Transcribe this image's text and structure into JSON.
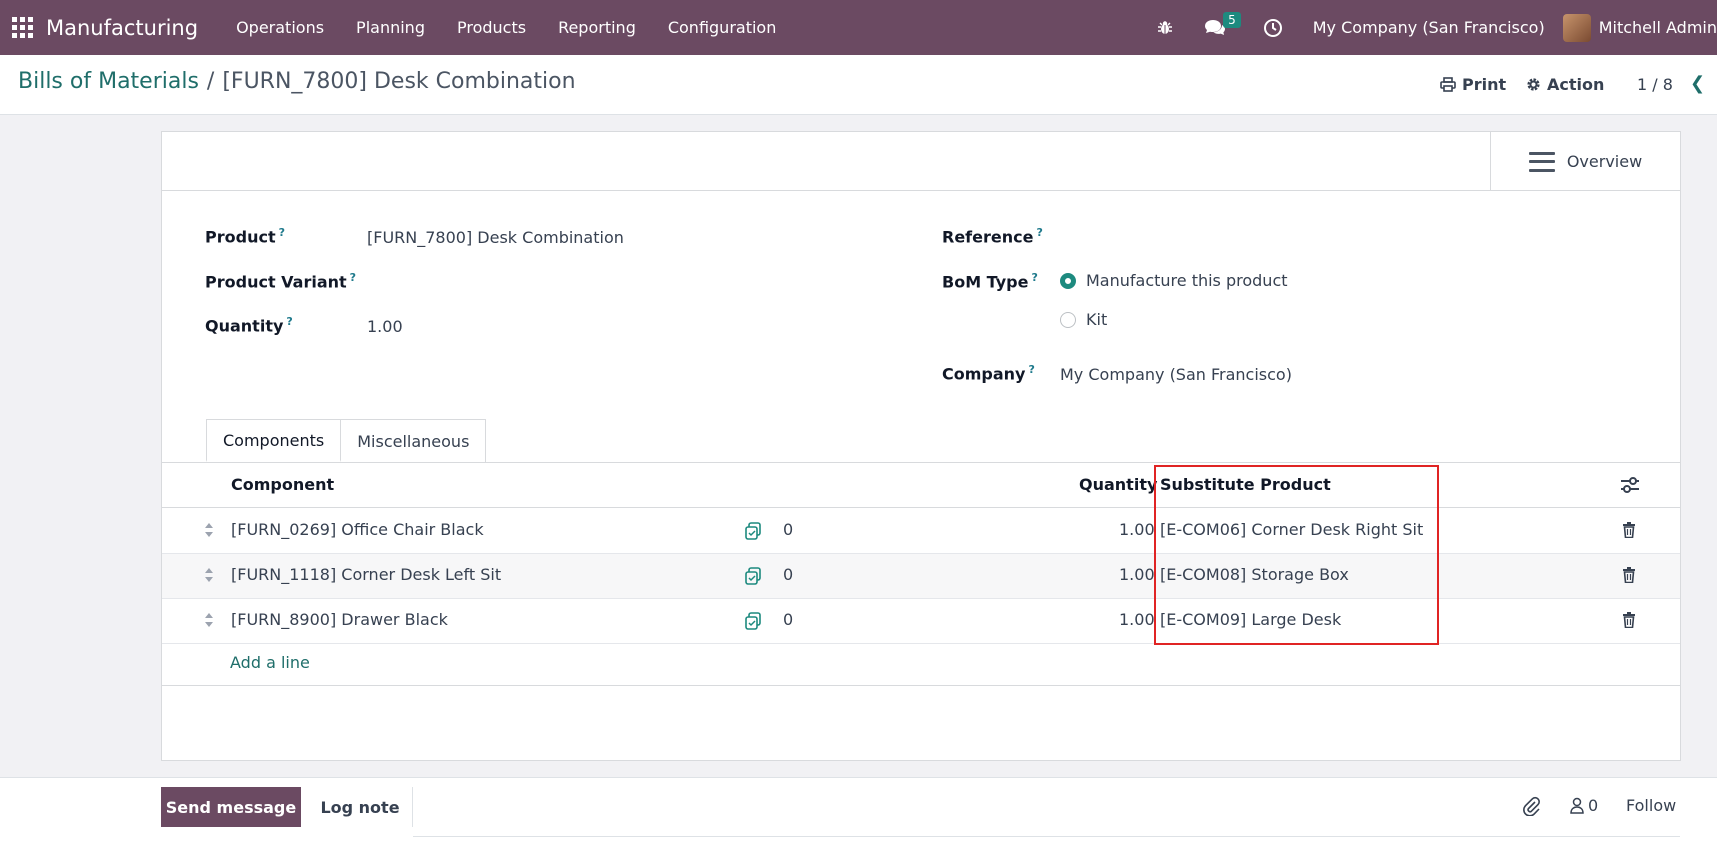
{
  "navbar": {
    "brand": "Manufacturing",
    "menu": [
      "Operations",
      "Planning",
      "Products",
      "Reporting",
      "Configuration"
    ],
    "messages_badge": "5",
    "company": "My Company (San Francisco)",
    "user": "Mitchell Admin"
  },
  "control": {
    "breadcrumb_parent": "Bills of Materials",
    "breadcrumb_sep": "/",
    "breadcrumb_current": "[FURN_7800] Desk Combination",
    "print_label": "Print",
    "action_label": "Action",
    "pager": "1 / 8"
  },
  "form": {
    "overview_label": "Overview",
    "product_label": "Product",
    "product_value": "[FURN_7800] Desk Combination",
    "variant_label": "Product Variant",
    "quantity_label": "Quantity",
    "quantity_value": "1.00",
    "reference_label": "Reference",
    "bom_type_label": "BoM Type",
    "bom_type_options": [
      "Manufacture this product",
      "Kit"
    ],
    "bom_type_selected": "Manufacture this product",
    "company_label": "Company",
    "company_value": "My Company (San Francisco)",
    "help_mark": "?"
  },
  "tabs": [
    "Components",
    "Miscellaneous"
  ],
  "table": {
    "headers": {
      "component": "Component",
      "quantity": "Quantity",
      "substitute": "Substitute Product"
    },
    "rows": [
      {
        "component": "[FURN_0269] Office Chair Black",
        "count": "0",
        "quantity": "1.00",
        "substitute": "[E-COM06] Corner Desk Right Sit"
      },
      {
        "component": "[FURN_1118] Corner Desk Left Sit",
        "count": "0",
        "quantity": "1.00",
        "substitute": "[E-COM08] Storage Box"
      },
      {
        "component": "[FURN_8900] Drawer Black",
        "count": "0",
        "quantity": "1.00",
        "substitute": "[E-COM09] Large Desk"
      }
    ],
    "add_line": "Add a line"
  },
  "chatter": {
    "send_message": "Send message",
    "log_note": "Log note",
    "followers_count": "0",
    "follow": "Follow"
  },
  "colors": {
    "navbar": "#6b4a62",
    "accent": "#1d8a7f",
    "link": "#1f6e6a",
    "highlight": "#e02424"
  }
}
